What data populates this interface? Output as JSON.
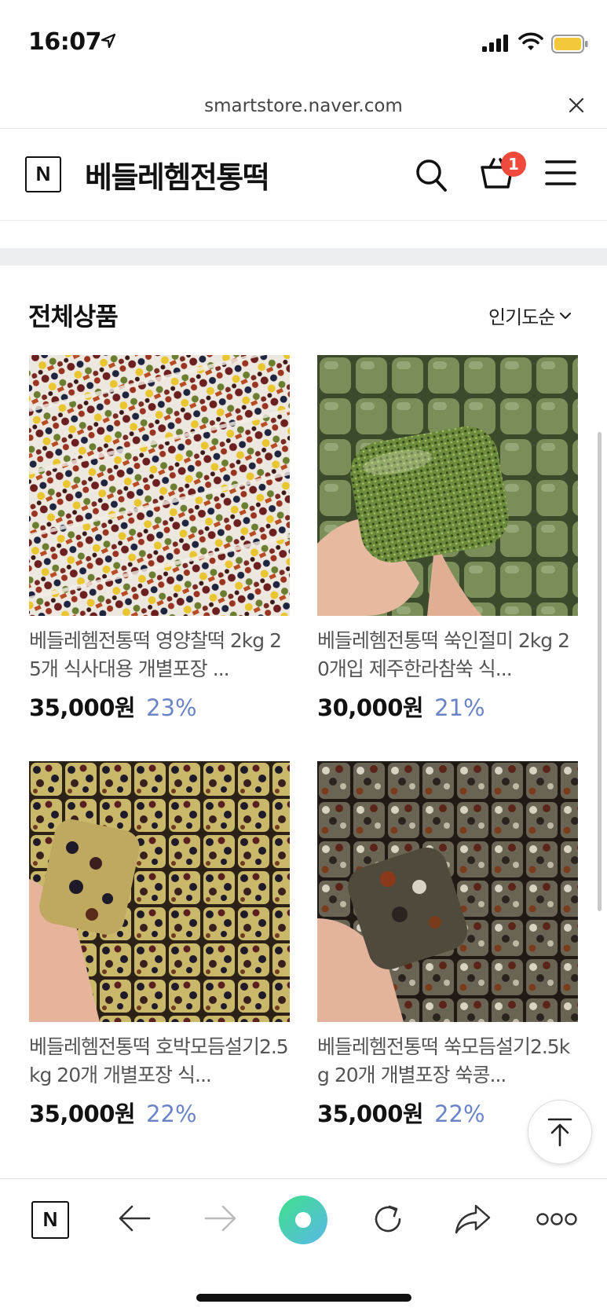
{
  "status_bar": {
    "time": "16:07"
  },
  "address_bar": {
    "url": "smartstore.naver.com"
  },
  "store_header": {
    "logo_letter": "N",
    "store_name": "베들레헴전통떡",
    "cart_count": "1"
  },
  "section": {
    "title": "전체상품",
    "sort_label": "인기도순"
  },
  "products": [
    {
      "name": "베들레헴전통떡 영양찰떡 2kg 25개 식사대용 개별포장 ...",
      "price": "35,000원",
      "discount": "23%"
    },
    {
      "name": "베들레헴전통떡 쑥인절미 2kg 20개입 제주한라참쑥 식...",
      "price": "30,000원",
      "discount": "21%"
    },
    {
      "name": "베들레헴전통떡 호박모듬설기2.5kg 20개 개별포장 식...",
      "price": "35,000원",
      "discount": "22%"
    },
    {
      "name": "베들레헴전통떡 쑥모듬설기2.5kg 20개 개별포장 쑥콩...",
      "price": "35,000원",
      "discount": "22%"
    }
  ],
  "bottom_toolbar": {
    "logo_letter": "N"
  },
  "colors": {
    "discount": "#6b84c7",
    "badge": "#f04a3c",
    "divider": "#eceef2",
    "green_button": "#5ad39a"
  },
  "icons": [
    "location-arrow-icon",
    "signal-icon",
    "wifi-icon",
    "battery-icon",
    "close-icon",
    "search-icon",
    "cart-icon",
    "menu-icon",
    "chevron-down-icon",
    "scroll-top-icon",
    "back-icon",
    "forward-icon",
    "reload-icon",
    "share-icon",
    "more-icon"
  ]
}
